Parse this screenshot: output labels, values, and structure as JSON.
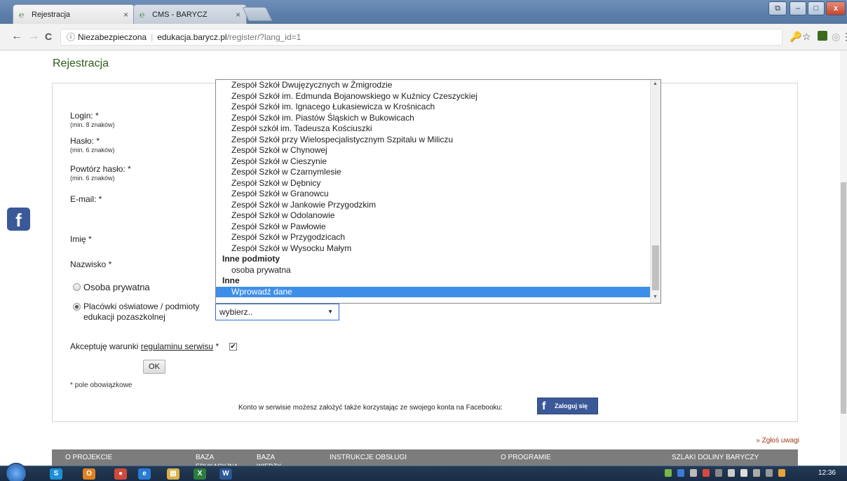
{
  "browser": {
    "tabs": [
      {
        "title": "Rejestracja",
        "favicon": "e-logo-icon",
        "active": true
      },
      {
        "title": "CMS - BARYCZ",
        "favicon": "e-logo-icon",
        "active": false
      }
    ],
    "close_glyph": "×",
    "security_label": "Niezabezpieczona",
    "url_host": "edukacja.barycz.pl",
    "url_path": "/register/?lang_id=1",
    "nav": {
      "back": "←",
      "forward": "→",
      "reload": "C"
    },
    "window_buttons": {
      "minimize": "–",
      "maximize": "□",
      "close": "x",
      "restore": "⧉"
    },
    "toolbar_icons": {
      "key": "🔑",
      "star": "☆",
      "menu": "⋮"
    }
  },
  "page": {
    "heading": "Rejestracja",
    "fields": {
      "login_label": "Login: *",
      "login_hint": "(min. 8 znaków)",
      "password_label": "Hasło: *",
      "password_hint": "(min. 6 znaków)",
      "repeat_label": "Powtórz hasło: *",
      "repeat_hint": "(min. 6 znaków)",
      "email_label": "E-mail: *",
      "firstname_label": "Imię *",
      "lastname_label": "Nazwisko *"
    },
    "radio_private": {
      "label": "Osoba prywatna",
      "checked": false
    },
    "radio_institution": {
      "label_line1": "Placówki oświatowe / podmioty",
      "label_line2": "edukacji pozaszkolnej",
      "checked": true
    },
    "select": {
      "value": "wybierz..",
      "arrow": "▼"
    },
    "dropdown_options": [
      {
        "label": "Zespół Szkół Dwujęzycznych w Żmigrodzie",
        "type": "option"
      },
      {
        "label": "Zespół Szkół im. Edmunda Bojanowskiego w Kuźnicy Czeszyckiej",
        "type": "option"
      },
      {
        "label": "Zespół Szkół im. Ignacego Łukasiewicza w Krośnicach",
        "type": "option"
      },
      {
        "label": "Zespół Szkół im. Piastów Śląskich w Bukowicach",
        "type": "option"
      },
      {
        "label": "Zespół szkół im. Tadeusza Kościuszki",
        "type": "option"
      },
      {
        "label": "Zespół Szkół przy Wielospecjalistycznym Szpitalu w Miliczu",
        "type": "option"
      },
      {
        "label": "Zespół Szkół w Chynowej",
        "type": "option"
      },
      {
        "label": "Zespół Szkół w Cieszynie",
        "type": "option"
      },
      {
        "label": "Zespół Szkół w Czarnymlesie",
        "type": "option"
      },
      {
        "label": "Zespół Szkół w Dębnicy",
        "type": "option"
      },
      {
        "label": "Zespół Szkół w Granowcu",
        "type": "option"
      },
      {
        "label": "Zespół Szkół w Jankowie Przygodzkim",
        "type": "option"
      },
      {
        "label": "Zespół Szkół w Odolanowie",
        "type": "option"
      },
      {
        "label": "Zespół Szkół w Pawłowie",
        "type": "option"
      },
      {
        "label": "Zespół Szkół w Przygodzicach",
        "type": "option"
      },
      {
        "label": "Zespół Szkół w Wysocku Małym",
        "type": "option"
      },
      {
        "label": "Inne podmioty",
        "type": "group"
      },
      {
        "label": "osoba prywatna",
        "type": "option"
      },
      {
        "label": "Inne",
        "type": "group"
      },
      {
        "label": "Wprowadź dane",
        "type": "option",
        "selected": true
      }
    ],
    "dropdown_scroll": {
      "up": "▲",
      "down": "▼"
    },
    "terms_prefix": "Akceptuję warunki ",
    "terms_link": "regulaminu serwisu",
    "terms_suffix": " *",
    "terms_checked": true,
    "checkmark": "✔",
    "ok_button": "OK",
    "required_note": "* pole obowiązkowe",
    "facebook_text": "Konto w serwisie możesz założyć także korzystając ze swojego konta na Facebooku:",
    "facebook_button": "Zaloguj się",
    "facebook_glyph": "f",
    "report_link": "» Zgłoś uwagi",
    "footer_nav": [
      {
        "label": "O PROJEKCIE",
        "sub": ""
      },
      {
        "label": "BAZA",
        "sub": "EDUKACYJNA"
      },
      {
        "label": "BAZA",
        "sub": "WIEDZY"
      },
      {
        "label": "INSTRUKCJE OBSŁUGI",
        "sub": ""
      },
      {
        "label": "O PROGRAMIE",
        "sub": ""
      },
      {
        "label": "SZLAKI DOLINY BARYCZY",
        "sub": ""
      }
    ]
  },
  "taskbar": {
    "clock": "12:36",
    "apps": [
      {
        "icon": "skype-icon",
        "glyph": "S",
        "color": "#1d8fd6"
      },
      {
        "icon": "outlook-icon",
        "glyph": "O",
        "color": "#e0821f"
      },
      {
        "icon": "chrome-icon",
        "glyph": "●",
        "color": "#d04a3a"
      },
      {
        "icon": "ie-icon",
        "glyph": "e",
        "color": "#2a7bd3"
      },
      {
        "icon": "explorer-icon",
        "glyph": "▤",
        "color": "#d8b24a"
      },
      {
        "icon": "excel-icon",
        "glyph": "X",
        "color": "#2c7d3f"
      },
      {
        "icon": "word-icon",
        "glyph": "W",
        "color": "#2b5797"
      }
    ]
  }
}
